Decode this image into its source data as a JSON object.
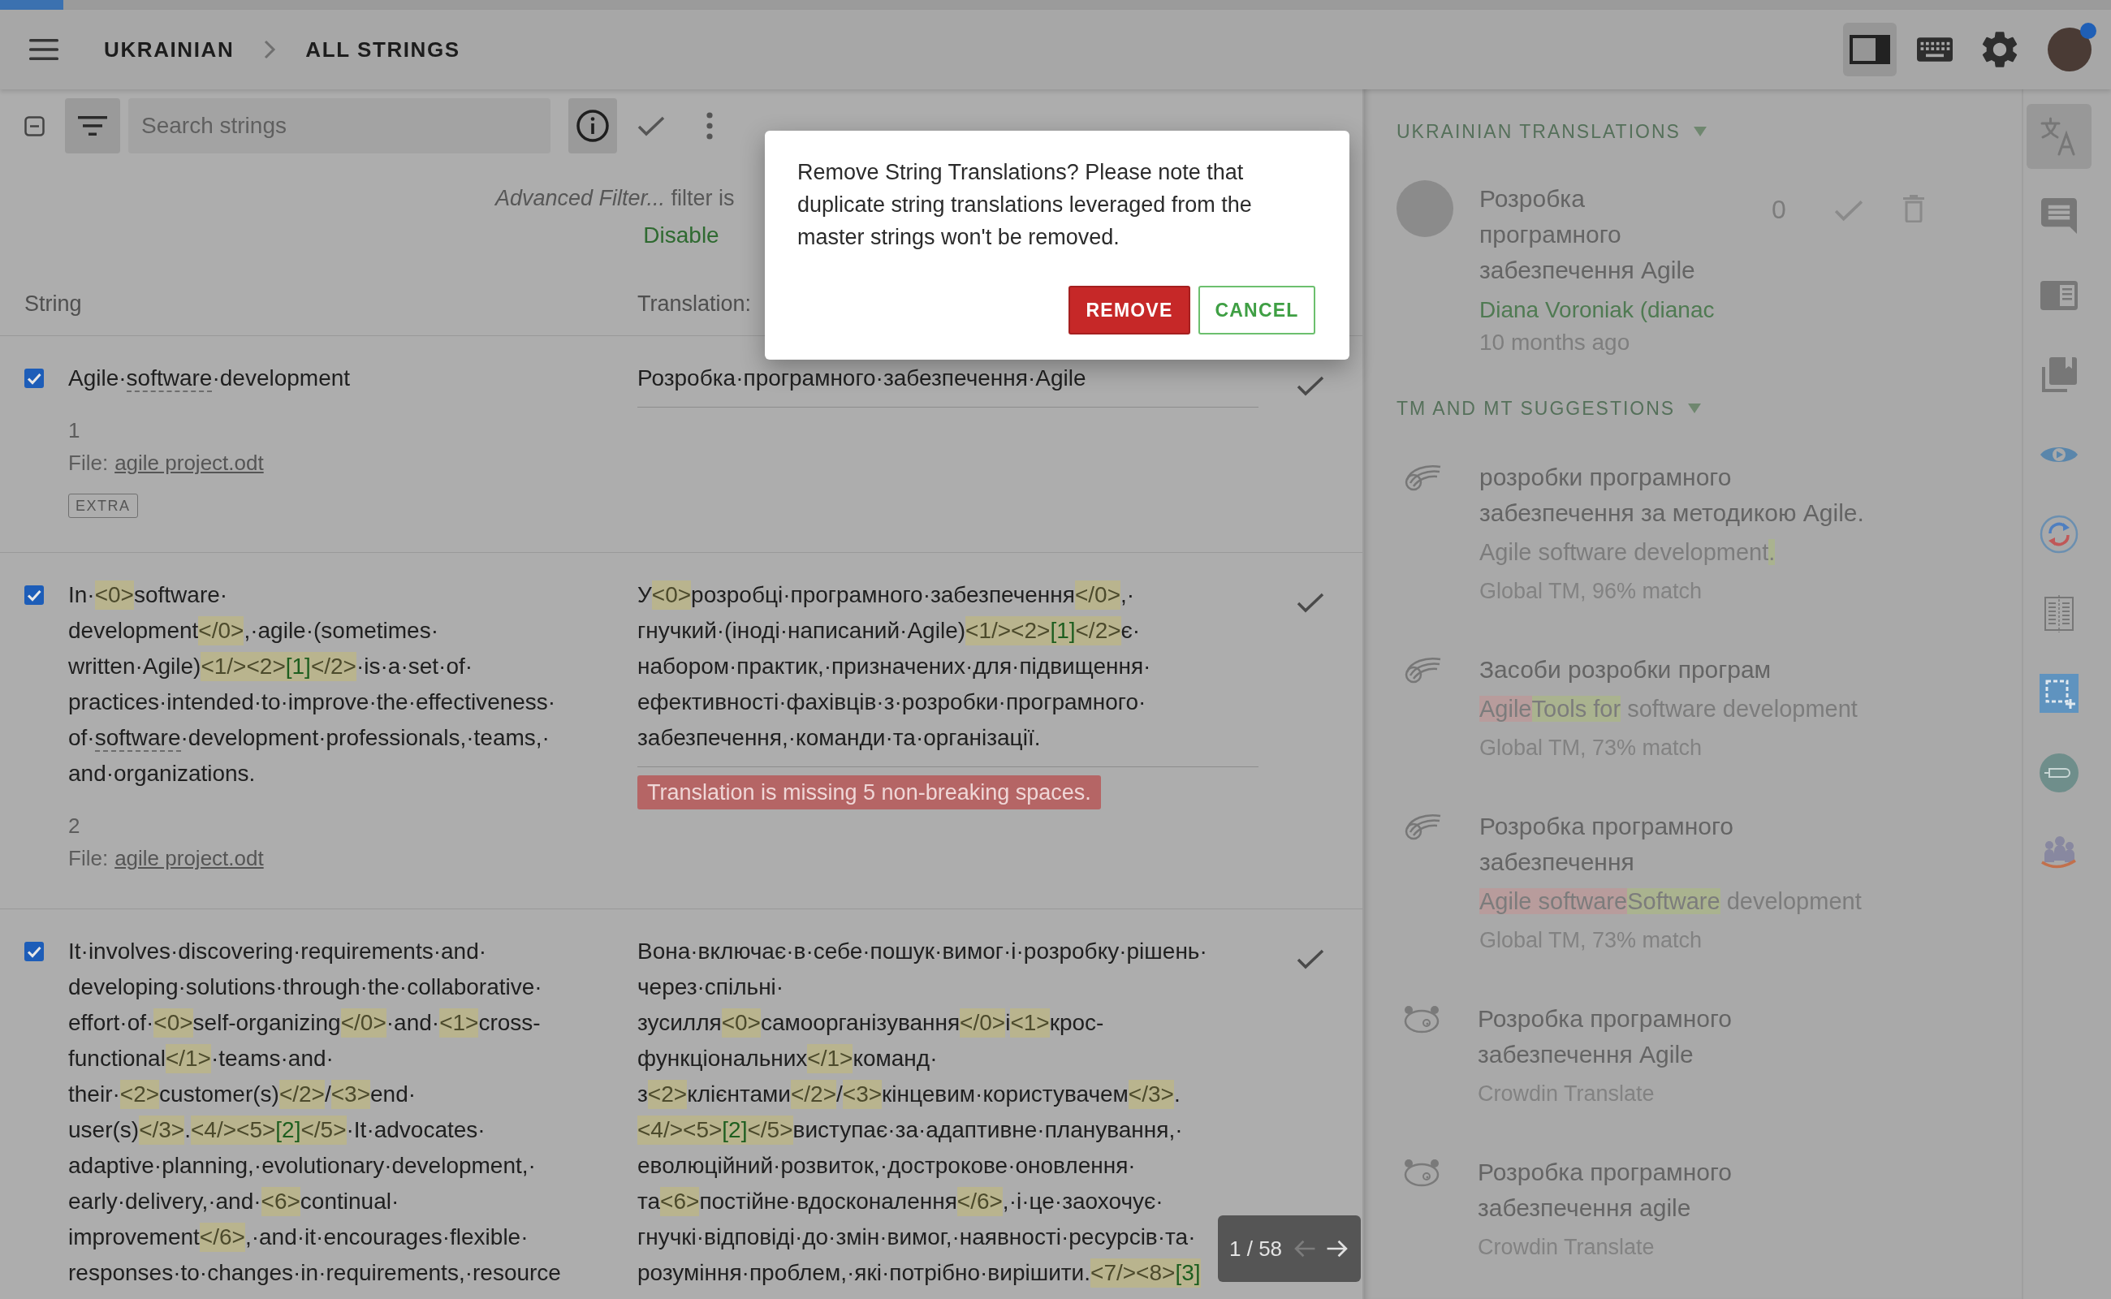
{
  "progress": {
    "level": 0.03
  },
  "header": {
    "breadcrumb": [
      "UKRAINIAN",
      "ALL STRINGS"
    ],
    "actions": [
      {
        "kind": "layout",
        "selected": true
      },
      {
        "kind": "keyboard",
        "selected": false
      },
      {
        "kind": "settings",
        "selected": false
      }
    ],
    "user": {
      "notification": true
    }
  },
  "toolbar": {
    "filter": {
      "selected": true
    },
    "search": {
      "placeholder": "Search strings"
    },
    "buttons": [
      {
        "kind": "info",
        "selected": true
      },
      {
        "kind": "approve",
        "selected": false
      },
      {
        "kind": "more",
        "selected": false
      }
    ]
  },
  "filter_notice": {
    "text": "*Advanced Filter...* filter is",
    "action": "Disable"
  },
  "columns": [
    "String",
    "Translation:"
  ],
  "rows": [
    {
      "checked": true,
      "source_lines": [
        [
          {
            "kind": "text",
            "text": "Agile·"
          },
          {
            "kind": "term",
            "text": "software"
          },
          {
            "kind": "text",
            "text": "·development"
          }
        ]
      ],
      "number": "1",
      "file_label": "File:",
      "file": "agile project.odt",
      "labels": [
        "EXTRA"
      ],
      "translation_lines": [
        [
          {
            "kind": "text",
            "text": "Розробка·програмного·забезпечення·Agile"
          }
        ]
      ]
    },
    {
      "checked": true,
      "source_lines": [
        [
          {
            "kind": "text",
            "text": "In·<0>software·"
          }
        ],
        [
          {
            "kind": "text",
            "text": "development</0>,·agile·(sometimes·"
          }
        ],
        [
          {
            "kind": "text",
            "text": "written·Agile)<1/><2>[1]</2>·is·a·set·of·"
          }
        ],
        [
          {
            "kind": "text",
            "text": "practices·intended·to·improve·the·effectiveness·"
          }
        ],
        [
          {
            "kind": "text",
            "text": "of·"
          },
          {
            "kind": "term",
            "text": "software"
          },
          {
            "kind": "text",
            "text": "·development·professionals,·teams,·"
          }
        ],
        [
          {
            "kind": "text",
            "text": "and·organizations."
          }
        ]
      ],
      "number": "2",
      "file_label": "File:",
      "file": "agile project.odt",
      "translation_lines": [
        [
          {
            "kind": "text",
            "text": "У<0>розробці·програмного·забезпечення</0>,·"
          }
        ],
        [
          {
            "kind": "text",
            "text": "гнучкий·(іноді·написаний·Agile)<1/><2>[1]</2>є·"
          }
        ],
        [
          {
            "kind": "text",
            "text": "набором·практик,·призначених·для·підвищення·"
          }
        ],
        [
          {
            "kind": "text",
            "text": "ефективності·фахівців·з·розробки·програмного·"
          }
        ],
        [
          {
            "kind": "text",
            "text": "забезпечення,·команди·та·організації."
          }
        ]
      ],
      "error": "Translation is missing 5 non-breaking spaces."
    },
    {
      "checked": true,
      "source_lines": [
        [
          {
            "kind": "text",
            "text": "It·involves·discovering·requirements·and·"
          }
        ],
        [
          {
            "kind": "text",
            "text": "developing·solutions·through·the·collaborative·"
          }
        ],
        [
          {
            "kind": "text",
            "text": "effort·of·<0>self-organizing</0>·and·<1>cross-"
          }
        ],
        [
          {
            "kind": "text",
            "text": "functional</1>·teams·and·"
          }
        ],
        [
          {
            "kind": "text",
            "text": "their·<2>customer(s)</2>/<3>end·"
          }
        ],
        [
          {
            "kind": "text",
            "text": "user(s)</3>.<4/><5>[2]</5>·It·advocates·"
          }
        ],
        [
          {
            "kind": "text",
            "text": "adaptive·planning,·evolutionary·development,·"
          }
        ],
        [
          {
            "kind": "text",
            "text": "early·delivery,·and·<6>continual·"
          }
        ],
        [
          {
            "kind": "text",
            "text": "improvement</6>,·and·it·encourages·flexible·"
          }
        ],
        [
          {
            "kind": "text",
            "text": "responses·to·changes·in·requirements,·resource"
          }
        ]
      ],
      "translation_lines": [
        [
          {
            "kind": "text",
            "text": "Вона·включає·в·себе·пошук·вимог·і·розробку·рішень·"
          }
        ],
        [
          {
            "kind": "text",
            "text": "через·спільні·"
          }
        ],
        [
          {
            "kind": "text",
            "text": "зусилля<0>самоорганізування</0>і<1>крос-"
          }
        ],
        [
          {
            "kind": "text",
            "text": "функціональних</1>команд·"
          }
        ],
        [
          {
            "kind": "text",
            "text": "з<2>клієнтами</2>/<3>кінцевим·користувачем</3>."
          }
        ],
        [
          {
            "kind": "text",
            "text": "<4/><5>[2]</5>виступає·за·адаптивне·планування,·"
          }
        ],
        [
          {
            "kind": "text",
            "text": "еволюційний·розвиток,·дострокове·оновлення·"
          }
        ],
        [
          {
            "kind": "text",
            "text": "та<6>постійне·вдосконалення</6>,·і·це·заохочує·"
          }
        ],
        [
          {
            "kind": "text",
            "text": "гнучкі·відповіді·до·змін·вимог,·наявності·ресурсів·та·"
          }
        ],
        [
          {
            "kind": "text",
            "text": "розуміння·проблем,·які·потрібно·вирішити.<7/><8>[3]"
          }
        ]
      ]
    }
  ],
  "pagination": {
    "label": "1 / 58",
    "previous_disabled": true,
    "next_disabled": false
  },
  "dialog": {
    "message": "Remove String Translations? Please note that duplicate string translations leveraged from the master strings won't be removed.",
    "buttons": [
      {
        "kind": "danger",
        "label": "REMOVE"
      },
      {
        "kind": "outline",
        "label": "CANCEL"
      }
    ]
  },
  "translations_panel": {
    "title": "UKRAINIAN TRANSLATIONS",
    "items": [
      {
        "lines": [
          "Розробка",
          "програмного",
          "забезпечення Agile"
        ],
        "author": "Diana Voroniak (dianac",
        "time": "10 months ago",
        "votes": "0"
      }
    ]
  },
  "suggestions_panel": {
    "title": "TM AND MT SUGGESTIONS",
    "items": [
      {
        "kind": "tm",
        "lines": [
          "розробки програмного",
          "забезпечення за методикою Agile."
        ],
        "source_diff": [
          {
            "kind": "same",
            "text": "Agile software development"
          },
          {
            "kind": "inserted",
            "text": "."
          }
        ],
        "origin": "Global TM, 96% match"
      },
      {
        "kind": "tm",
        "lines": [
          "Засоби розробки програм"
        ],
        "source_diff": [
          {
            "kind": "deleted",
            "text": "Agile"
          },
          {
            "kind": "inserted",
            "text": "Tools for"
          },
          {
            "kind": "same",
            "text": " software development"
          }
        ],
        "origin": "Global TM, 73% match"
      },
      {
        "kind": "tm",
        "lines": [
          "Розробка програмного",
          "забезпечення"
        ],
        "source_diff": [
          {
            "kind": "deleted",
            "text": "Agile software"
          },
          {
            "kind": "inserted",
            "text": "Software"
          },
          {
            "kind": "same",
            "text": " development"
          }
        ],
        "origin": "Global TM, 73% match"
      },
      {
        "kind": "mt",
        "lines": [
          "Розробка програмного",
          "забезпечення Agile"
        ],
        "origin": "Crowdin Translate"
      },
      {
        "kind": "mt",
        "lines": [
          "Розробка програмного",
          "забезпечення agile"
        ],
        "origin": "Crowdin Translate"
      }
    ]
  },
  "tools": [
    {
      "kind": "translate",
      "selected": true
    },
    {
      "kind": "comments",
      "selected": false
    },
    {
      "kind": "panel",
      "selected": false
    },
    {
      "kind": "library",
      "selected": false
    },
    {
      "kind": "preview",
      "selected": false
    },
    {
      "kind": "sync",
      "selected": false
    },
    {
      "kind": "document",
      "selected": false
    },
    {
      "kind": "selection",
      "selected": false
    },
    {
      "kind": "label",
      "selected": false
    },
    {
      "kind": "people",
      "selected": false
    }
  ]
}
